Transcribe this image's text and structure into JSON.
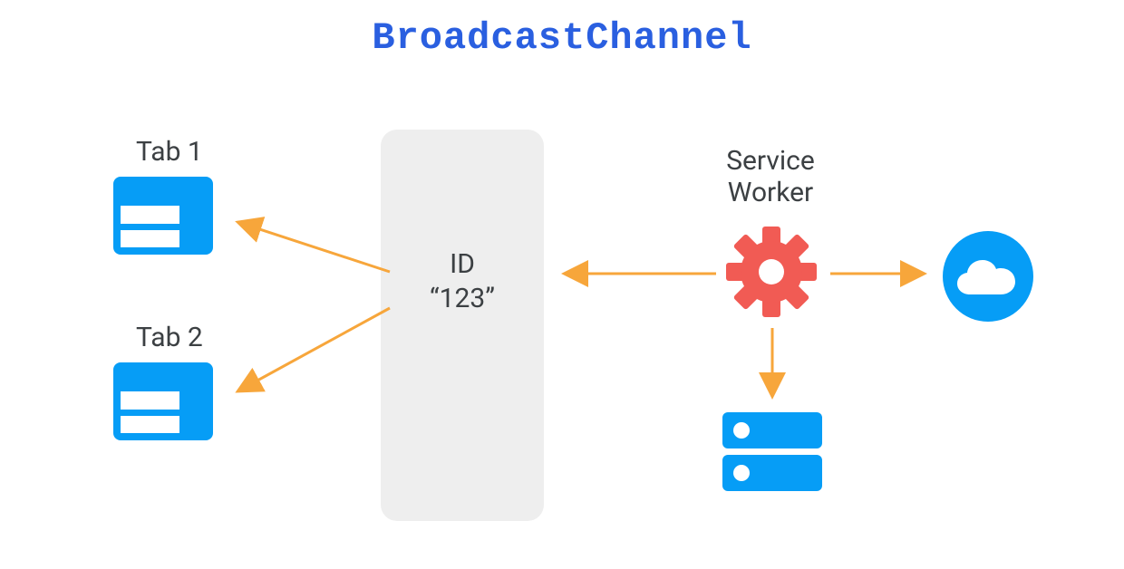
{
  "title": "BroadcastChannel",
  "channel": {
    "id_label": "ID",
    "id_value": "“123”"
  },
  "tabs": [
    {
      "label": "Tab 1"
    },
    {
      "label": "Tab 2"
    }
  ],
  "service_worker": {
    "label_line1": "Service",
    "label_line2": "Worker"
  },
  "colors": {
    "blue": "#069df6",
    "title_blue": "#2a5fe0",
    "orange": "#f7a63b",
    "gear_red": "#f15b54",
    "grey_box": "#eeeeee"
  },
  "icons": {
    "tab": "browser-window-icon",
    "gear": "gear-icon",
    "cloud": "cloud-icon",
    "server": "server-stack-icon"
  }
}
